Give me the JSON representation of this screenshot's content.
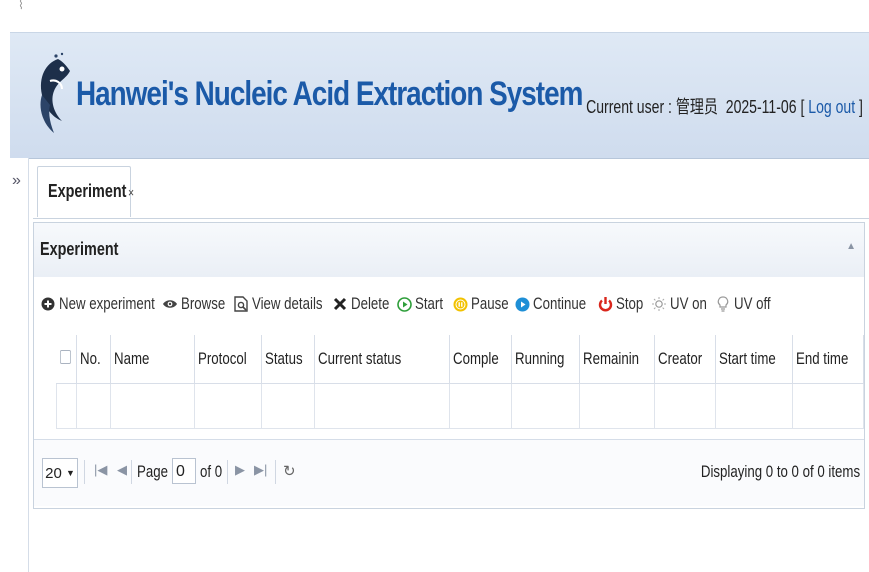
{
  "header": {
    "title": "Hanwei's Nucleic Acid Extraction System",
    "user_label": "Current user : 管理员",
    "date": "2025-11-06",
    "logout_open": "[",
    "logout_label": "Log out",
    "logout_close": "]"
  },
  "sidebar": {
    "expand_icon": "double-chevron-right-icon",
    "expand_glyph": "»"
  },
  "tabs": [
    {
      "label": "Experiment",
      "close": "×"
    }
  ],
  "panel": {
    "title": "Experiment",
    "collapse_glyph": "▲"
  },
  "toolbar": {
    "new": "New experiment",
    "browse": "Browse",
    "details": "View details",
    "delete": "Delete",
    "start": "Start",
    "pause": "Pause",
    "continue": "Continue",
    "stop": "Stop",
    "uv_on": "UV on",
    "uv_off": "UV off"
  },
  "grid": {
    "columns": [
      "No.",
      "Name",
      "Protocol",
      "Status",
      "Current status",
      "Comple",
      "Running",
      "Remainin",
      "Creator",
      "Start time",
      "End time"
    ]
  },
  "pager": {
    "page_size": "20",
    "page_label": "Page",
    "page_value": "0",
    "of_label": "of 0",
    "display_info": "Displaying 0 to 0 of 0 items"
  },
  "colors": {
    "brand": "#1b5aa8",
    "header_bg": "#d6e2f1",
    "start": "#2e9e3a",
    "pause": "#e8b500",
    "continue": "#1e8fd6",
    "stop": "#d9261c"
  }
}
